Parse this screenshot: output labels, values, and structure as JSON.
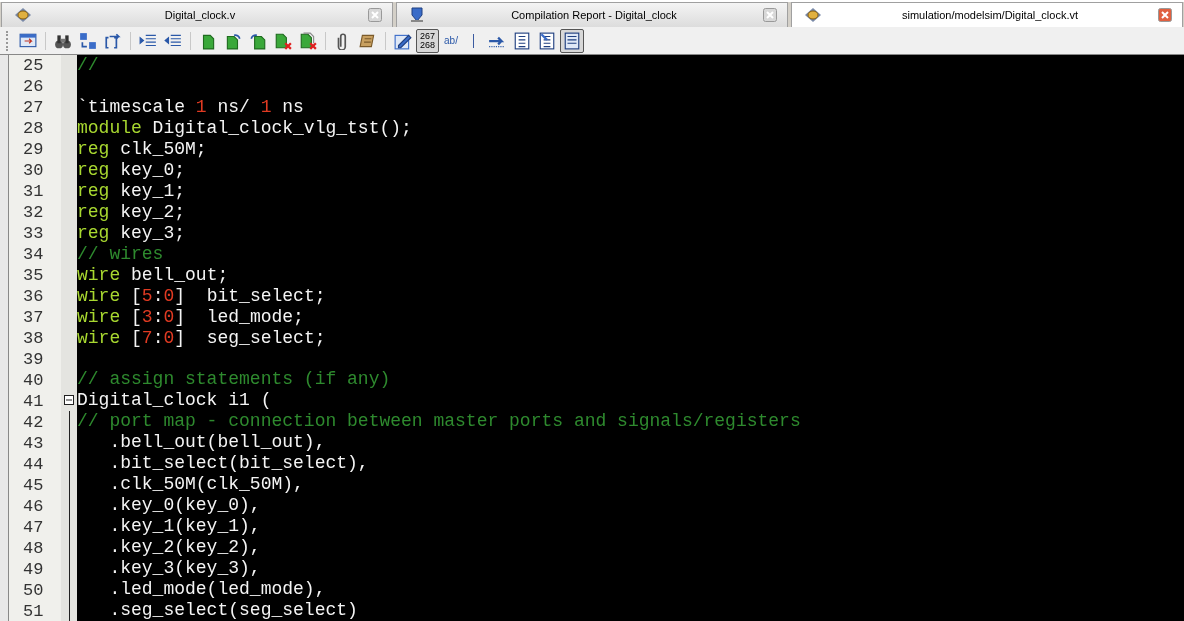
{
  "tabs": [
    {
      "label": "Digital_clock.v",
      "selected": false
    },
    {
      "label": "Compilation Report - Digital_clock",
      "selected": false
    },
    {
      "label": "simulation/modelsim/Digital_clock.vt",
      "selected": true
    }
  ],
  "toolbar": {
    "groups": [
      {
        "buttons": [
          {
            "selected": false
          }
        ]
      },
      {
        "buttons": [
          {
            "selected": false
          },
          {
            "selected": false
          },
          {
            "selected": false
          }
        ]
      },
      {
        "buttons": [
          {
            "selected": false
          },
          {
            "selected": false
          }
        ]
      },
      {
        "buttons": [
          {
            "selected": false
          },
          {
            "selected": false
          },
          {
            "selected": false
          },
          {
            "selected": false
          },
          {
            "selected": false
          }
        ]
      },
      {
        "buttons": [
          {
            "selected": false
          },
          {
            "selected": false
          }
        ]
      },
      {
        "buttons": [
          {
            "selected": false
          },
          {
            "selected": true,
            "label": "267\n268"
          },
          {
            "selected": false,
            "label": "ab/"
          }
        ]
      },
      {
        "buttons": [
          {
            "selected": false
          },
          {
            "selected": false
          },
          {
            "selected": false
          },
          {
            "selected": true
          }
        ]
      }
    ]
  },
  "editor": {
    "lines": [
      {
        "number": "25",
        "tokens": [
          {
            "kind": "comment",
            "text": "//"
          }
        ]
      },
      {
        "number": "26"
      },
      {
        "number": "27",
        "tokens": [
          {
            "kind": "plain",
            "text": "`timescale "
          },
          {
            "kind": "number",
            "text": "1"
          },
          {
            "kind": "plain",
            "text": " ns/ "
          },
          {
            "kind": "number",
            "text": "1"
          },
          {
            "kind": "plain",
            "text": " ns"
          }
        ]
      },
      {
        "number": "28",
        "tokens": [
          {
            "kind": "keyword",
            "text": "module"
          },
          {
            "kind": "plain",
            "text": " Digital_clock_vlg_tst();"
          }
        ]
      },
      {
        "number": "29",
        "tokens": [
          {
            "kind": "keyword",
            "text": "reg"
          },
          {
            "kind": "plain",
            "text": " clk_50M;"
          }
        ]
      },
      {
        "number": "30",
        "tokens": [
          {
            "kind": "keyword",
            "text": "reg"
          },
          {
            "kind": "plain",
            "text": " key_0;"
          }
        ]
      },
      {
        "number": "31",
        "tokens": [
          {
            "kind": "keyword",
            "text": "reg"
          },
          {
            "kind": "plain",
            "text": " key_1;"
          }
        ]
      },
      {
        "number": "32",
        "tokens": [
          {
            "kind": "keyword",
            "text": "reg"
          },
          {
            "kind": "plain",
            "text": " key_2;"
          }
        ]
      },
      {
        "number": "33",
        "tokens": [
          {
            "kind": "keyword",
            "text": "reg"
          },
          {
            "kind": "plain",
            "text": " key_3;"
          }
        ]
      },
      {
        "number": "34",
        "tokens": [
          {
            "kind": "comment",
            "text": "// wires"
          }
        ]
      },
      {
        "number": "35",
        "tokens": [
          {
            "kind": "keyword",
            "text": "wire"
          },
          {
            "kind": "plain",
            "text": " bell_out;"
          }
        ]
      },
      {
        "number": "36",
        "tokens": [
          {
            "kind": "keyword",
            "text": "wire"
          },
          {
            "kind": "plain",
            "text": " ["
          },
          {
            "kind": "number",
            "text": "5"
          },
          {
            "kind": "plain",
            "text": ":"
          },
          {
            "kind": "number",
            "text": "0"
          },
          {
            "kind": "plain",
            "text": "]  bit_select;"
          }
        ]
      },
      {
        "number": "37",
        "tokens": [
          {
            "kind": "keyword",
            "text": "wire"
          },
          {
            "kind": "plain",
            "text": " ["
          },
          {
            "kind": "number",
            "text": "3"
          },
          {
            "kind": "plain",
            "text": ":"
          },
          {
            "kind": "number",
            "text": "0"
          },
          {
            "kind": "plain",
            "text": "]  led_mode;"
          }
        ]
      },
      {
        "number": "38",
        "tokens": [
          {
            "kind": "keyword",
            "text": "wire"
          },
          {
            "kind": "plain",
            "text": " ["
          },
          {
            "kind": "number",
            "text": "7"
          },
          {
            "kind": "plain",
            "text": ":"
          },
          {
            "kind": "number",
            "text": "0"
          },
          {
            "kind": "plain",
            "text": "]  seg_select;"
          }
        ]
      },
      {
        "number": "39"
      },
      {
        "number": "40",
        "tokens": [
          {
            "kind": "comment",
            "text": "// assign statements (if any)"
          }
        ]
      },
      {
        "number": "41",
        "expanded": true,
        "tokens": [
          {
            "kind": "plain",
            "text": "Digital_clock i1 ("
          }
        ]
      },
      {
        "number": "42",
        "in_fold": true,
        "tokens": [
          {
            "kind": "comment",
            "text": "// port map - connection between master ports and signals/registers"
          }
        ]
      },
      {
        "number": "43",
        "in_fold": true,
        "tokens": [
          {
            "kind": "plain",
            "text": "   .bell_out(bell_out),"
          }
        ]
      },
      {
        "number": "44",
        "in_fold": true,
        "tokens": [
          {
            "kind": "plain",
            "text": "   .bit_select(bit_select),"
          }
        ]
      },
      {
        "number": "45",
        "in_fold": true,
        "tokens": [
          {
            "kind": "plain",
            "text": "   .clk_50M(clk_50M),"
          }
        ]
      },
      {
        "number": "46",
        "in_fold": true,
        "tokens": [
          {
            "kind": "plain",
            "text": "   .key_0(key_0),"
          }
        ]
      },
      {
        "number": "47",
        "in_fold": true,
        "tokens": [
          {
            "kind": "plain",
            "text": "   .key_1(key_1),"
          }
        ]
      },
      {
        "number": "48",
        "in_fold": true,
        "tokens": [
          {
            "kind": "plain",
            "text": "   .key_2(key_2),"
          }
        ]
      },
      {
        "number": "49",
        "in_fold": true,
        "tokens": [
          {
            "kind": "plain",
            "text": "   .key_3(key_3),"
          }
        ]
      },
      {
        "number": "50",
        "in_fold": true,
        "tokens": [
          {
            "kind": "plain",
            "text": "   .led_mode(led_mode),"
          }
        ]
      },
      {
        "number": "51",
        "in_fold": true,
        "tokens": [
          {
            "kind": "plain",
            "text": "   .seg_select(seg_select)"
          }
        ]
      }
    ]
  }
}
